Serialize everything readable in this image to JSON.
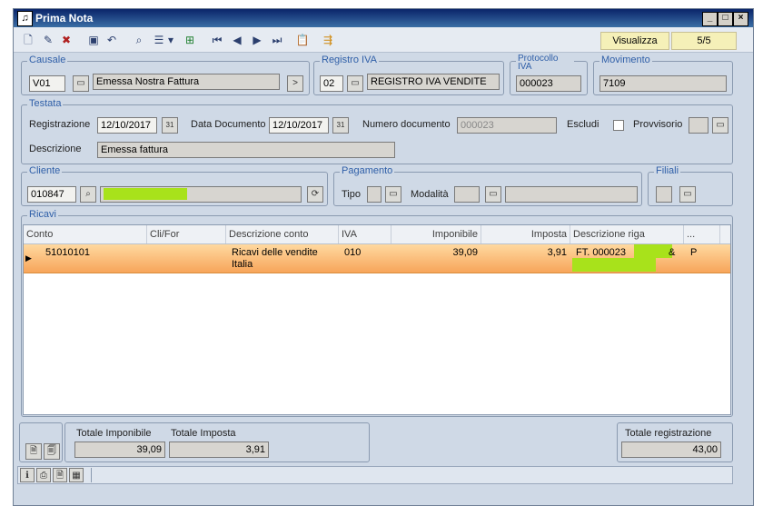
{
  "window": {
    "title": "Prima Nota"
  },
  "toolbar": {
    "mode": "Visualizza",
    "record_position": "5/5"
  },
  "causale": {
    "label": "Causale",
    "code": "V01",
    "description": "Emessa Nostra Fattura",
    "go_label": ">"
  },
  "registro_iva": {
    "label": "Registro IVA",
    "code": "02",
    "description": "REGISTRO IVA VENDITE"
  },
  "protocollo": {
    "label": "Protocollo IVA",
    "value": "000023"
  },
  "movimento": {
    "label": "Movimento",
    "value": "7109"
  },
  "testata": {
    "label": "Testata",
    "registrazione_label": "Registrazione",
    "registrazione": "12/10/2017",
    "data_documento_label": "Data Documento",
    "data_documento": "12/10/2017",
    "numero_documento_label": "Numero documento",
    "numero_documento": "000023",
    "escludi_label": "Escludi",
    "provvisorio_label": "Provvisorio",
    "descrizione_label": "Descrizione",
    "descrizione": "Emessa fattura"
  },
  "cliente": {
    "label": "Cliente",
    "code": "010847",
    "name": ""
  },
  "pagamento": {
    "label": "Pagamento",
    "tipo_label": "Tipo",
    "modalita_label": "Modalità"
  },
  "filiali": {
    "label": "Filiali"
  },
  "ricavi": {
    "label": "Ricavi",
    "columns": [
      "Conto",
      "Cli/For",
      "Descrizione conto",
      "IVA",
      "Imponibile",
      "Imposta",
      "Descrizione riga",
      "..."
    ],
    "rows": [
      {
        "conto": "51010101",
        "clifor": "",
        "descrizione_conto": "Ricavi delle vendite Italia",
        "iva": "010",
        "imponibile": "39,09",
        "imposta": "3,91",
        "descrizione_riga": "FT. 000023  C",
        "descrizione_riga_suffix": "&",
        "flag": "P"
      }
    ]
  },
  "totali": {
    "imponibile_label": "Totale Imponibile",
    "imponibile": "39,09",
    "imposta_label": "Totale Imposta",
    "imposta": "3,91",
    "registrazione_label": "Totale registrazione",
    "registrazione": "43,00"
  },
  "colors": {
    "title_bar": "#0a246a",
    "panel": "#cfd9e6",
    "group_label": "#2f5fa8",
    "row_selected": "#f7a55a",
    "redaction": "#a8e21b"
  }
}
